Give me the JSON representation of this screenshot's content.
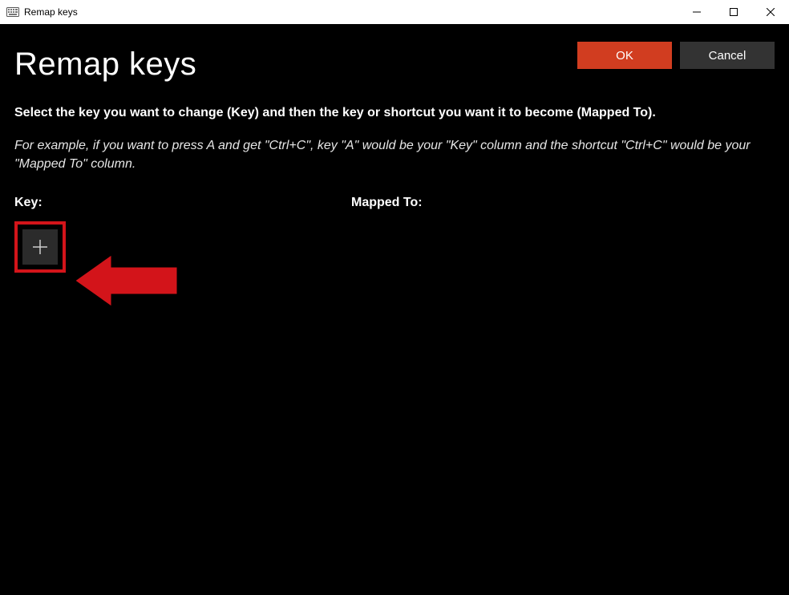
{
  "window": {
    "title": "Remap keys"
  },
  "header": {
    "page_title": "Remap keys",
    "ok_label": "OK",
    "cancel_label": "Cancel"
  },
  "body": {
    "instruction": "Select the key you want to change (Key) and then the key or shortcut you want it to become (Mapped To).",
    "example": "For example, if you want to press A and get \"Ctrl+C\", key \"A\" would be your \"Key\" column and the shortcut \"Ctrl+C\" would be your \"Mapped To\" column.",
    "key_column_label": "Key:",
    "mapped_column_label": "Mapped To:"
  },
  "icons": {
    "add": "plus-icon",
    "app": "keyboard-icon",
    "minimize": "minimize-icon",
    "maximize": "maximize-icon",
    "close": "close-icon"
  },
  "annotation": {
    "highlight_color": "#d3141a"
  }
}
